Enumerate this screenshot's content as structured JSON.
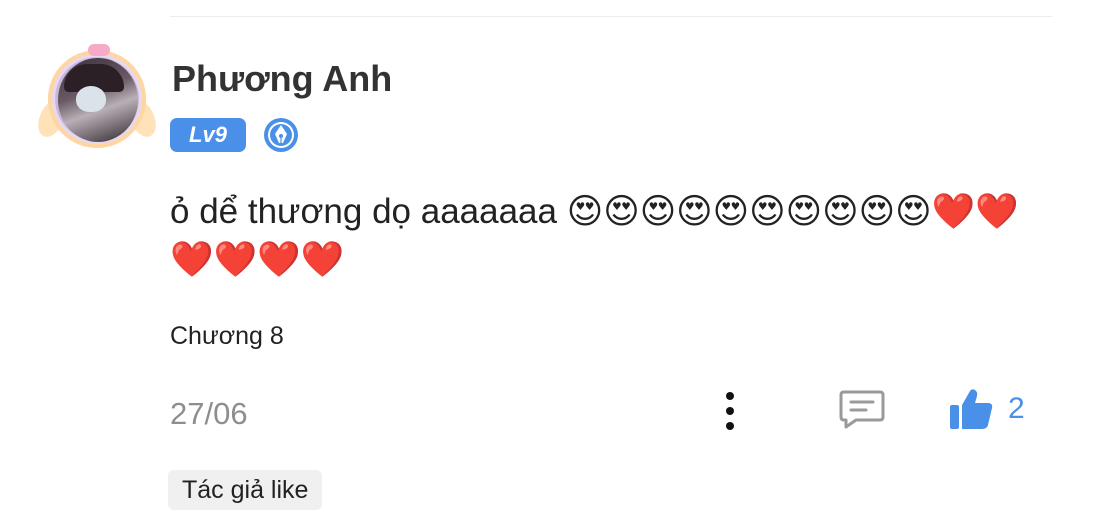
{
  "user": {
    "name": "Phương Anh",
    "level": "Lv9"
  },
  "comment": {
    "text": "ỏ dể thương dọ aaaaaaa",
    "emojis": "😍😍😍😍😍😍😍😍😍😍❤️❤️❤️❤️❤️❤️"
  },
  "chapter": "Chương 8",
  "date": "27/06",
  "like_count": "2",
  "author_like_label": "Tác giả like",
  "colors": {
    "accent": "#4a90e8",
    "username": "#333333",
    "date": "#8e8e8e",
    "reply_icon": "#9a9a9a"
  },
  "icons": {
    "more": "more-vertical-icon",
    "reply": "comment-icon",
    "like": "thumbs-up-icon",
    "badge": "pen-nib-icon"
  }
}
